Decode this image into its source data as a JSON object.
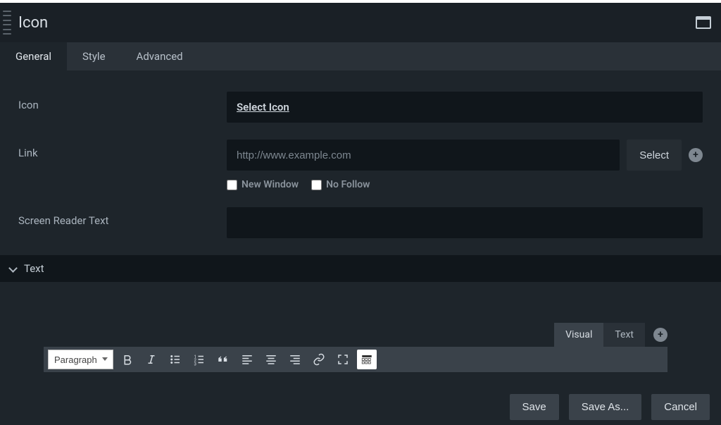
{
  "header": {
    "title": "Icon"
  },
  "tabs": [
    {
      "label": "General",
      "active": true
    },
    {
      "label": "Style",
      "active": false
    },
    {
      "label": "Advanced",
      "active": false
    }
  ],
  "fields": {
    "icon": {
      "label": "Icon",
      "action": "Select Icon"
    },
    "link": {
      "label": "Link",
      "placeholder": "http://www.example.com",
      "value": "",
      "select_btn": "Select",
      "new_window": "New Window",
      "no_follow": "No Follow"
    },
    "screen_reader": {
      "label": "Screen Reader Text",
      "value": ""
    }
  },
  "section": {
    "text": "Text"
  },
  "editor": {
    "tabs": {
      "visual": "Visual",
      "text": "Text"
    },
    "format": "Paragraph",
    "buttons": [
      "bold",
      "italic",
      "bullet-list",
      "number-list",
      "blockquote",
      "align-left",
      "align-center",
      "align-right",
      "link",
      "fullscreen",
      "toolbar-toggle"
    ]
  },
  "footer": {
    "save": "Save",
    "save_as": "Save As...",
    "cancel": "Cancel"
  }
}
